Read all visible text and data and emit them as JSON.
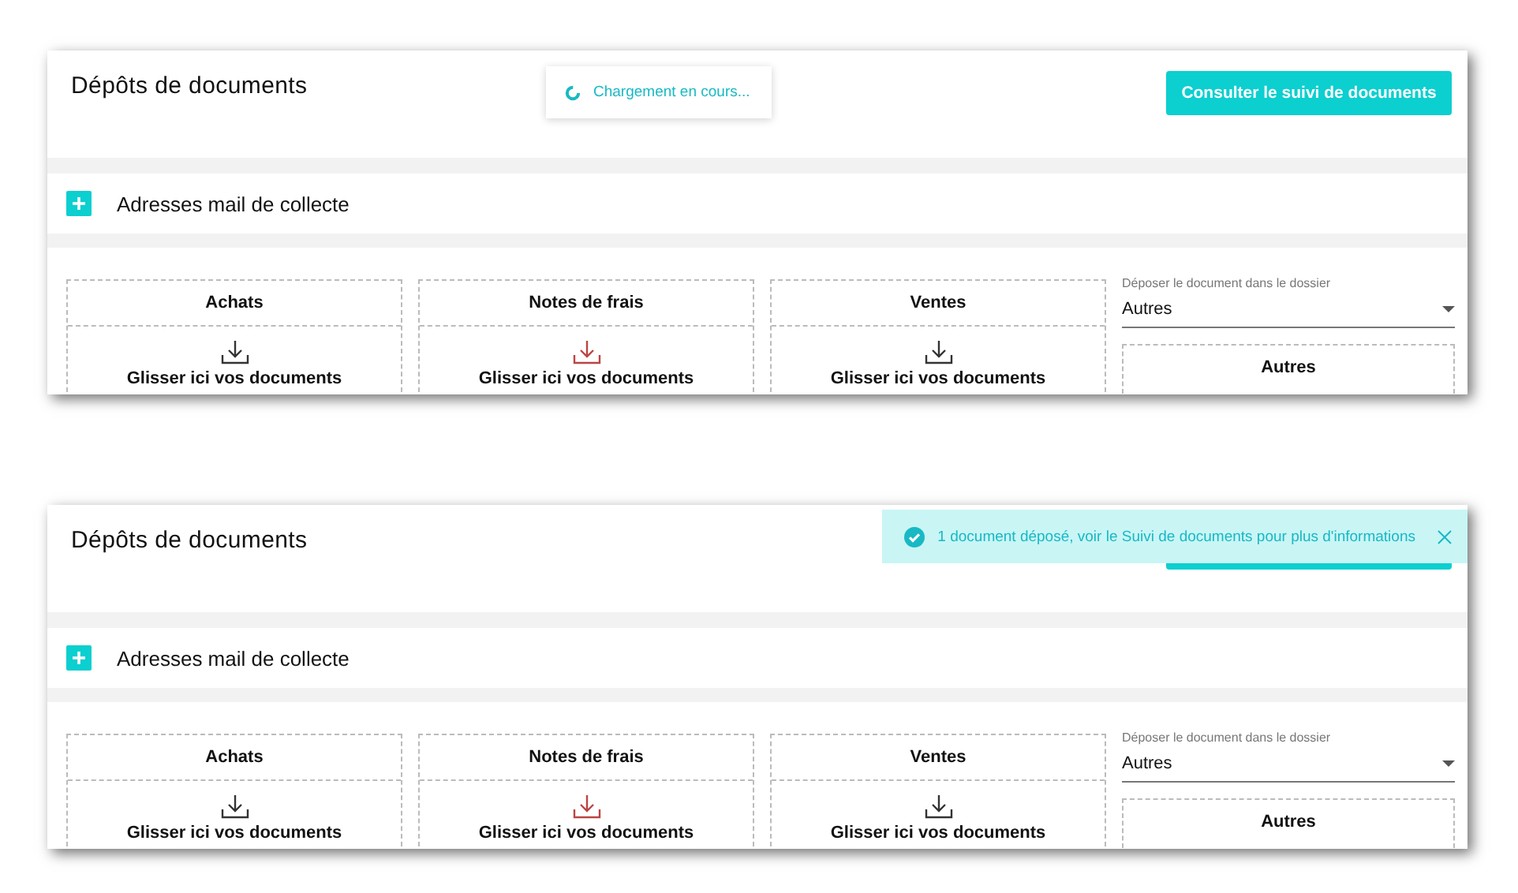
{
  "screens": [
    {
      "title": "Dépôts de documents",
      "toast": {
        "kind": "loading",
        "message": "Chargement en cours..."
      },
      "button": {
        "label": "Consulter le suivi de documents"
      },
      "section": {
        "label": "Adresses mail de collecte"
      },
      "drop_zones": [
        {
          "label": "Achats",
          "hint": "Glisser ici vos documents"
        },
        {
          "label": "Notes de frais",
          "hint": "Glisser ici vos documents"
        },
        {
          "label": "Ventes",
          "hint": "Glisser ici vos documents"
        }
      ],
      "folder": {
        "label": "Déposer le document dans le dossier",
        "value": "Autres",
        "zone_label": "Autres"
      }
    },
    {
      "title": "Dépôts de documents",
      "toast": {
        "kind": "success",
        "message": "1 document déposé, voir le Suivi de documents pour plus d'informations"
      },
      "button": {
        "covered": true
      },
      "section": {
        "label": "Adresses mail de collecte"
      },
      "drop_zones": [
        {
          "label": "Achats",
          "hint": "Glisser ici vos documents"
        },
        {
          "label": "Notes de frais",
          "hint": "Glisser ici vos documents"
        },
        {
          "label": "Ventes",
          "hint": "Glisser ici vos documents"
        }
      ],
      "folder": {
        "label": "Déposer le document dans le dossier",
        "value": "Autres",
        "zone_label": "Autres"
      }
    }
  ]
}
